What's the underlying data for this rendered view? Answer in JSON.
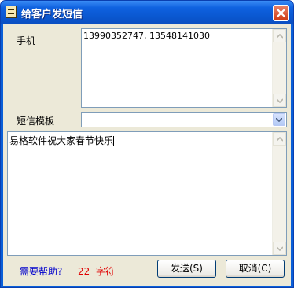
{
  "window": {
    "title": "给客户发短信"
  },
  "phone": {
    "label": "手机",
    "value": "13990352747, 13548141030"
  },
  "template": {
    "label": "短信模板",
    "selected": ""
  },
  "message": {
    "text": "易格软件祝大家春节快乐"
  },
  "footer": {
    "help_link": "需要帮助?",
    "char_count": "22",
    "char_unit": "字符"
  },
  "buttons": {
    "send": "发送(S)",
    "cancel": "取消(C)"
  },
  "icons": {
    "app": "notepad-icon",
    "close": "close-icon",
    "scroll_up": "arrow-up-icon",
    "scroll_down": "arrow-down-icon",
    "dropdown": "chevron-down-icon"
  }
}
